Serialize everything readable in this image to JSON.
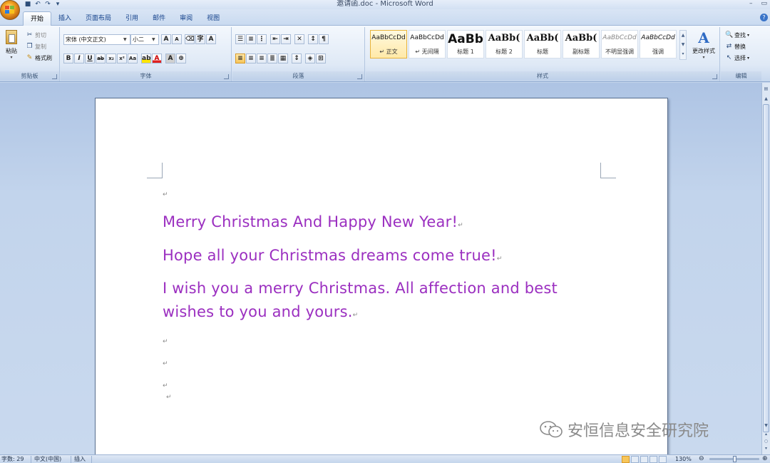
{
  "window": {
    "title": "邀请函.doc - Microsoft Word",
    "minimize": "–",
    "restore": "▭",
    "help": "?"
  },
  "qat": {
    "save_icon": "save-icon",
    "undo_icon": "undo-icon",
    "redo_icon": "redo-icon",
    "customize_icon": "customize-icon"
  },
  "tabs": [
    {
      "label": "开始",
      "active": true
    },
    {
      "label": "插入"
    },
    {
      "label": "页面布局"
    },
    {
      "label": "引用"
    },
    {
      "label": "邮件"
    },
    {
      "label": "审阅"
    },
    {
      "label": "视图"
    }
  ],
  "ribbon": {
    "clipboard": {
      "label": "剪贴板",
      "paste": "粘贴",
      "cut": "剪切",
      "copy": "复制",
      "format_painter": "格式刷"
    },
    "font": {
      "label": "字体",
      "font_name": "宋体 (中文正文)",
      "font_size": "小二"
    },
    "paragraph": {
      "label": "段落"
    },
    "styles": {
      "label": "样式",
      "items": [
        {
          "sample": "AaBbCcDd",
          "name": "↵ 正文"
        },
        {
          "sample": "AaBbCcDd",
          "name": "↵ 无间隔"
        },
        {
          "sample": "AaBb",
          "name": "标题 1"
        },
        {
          "sample": "AaBb(",
          "name": "标题 2"
        },
        {
          "sample": "AaBb(",
          "name": "标题"
        },
        {
          "sample": "AaBb(",
          "name": "副标题"
        },
        {
          "sample": "AaBbCcDd",
          "name": "不明显强调"
        },
        {
          "sample": "AaBbCcDd",
          "name": "强调"
        }
      ],
      "change_styles": "更改样式"
    },
    "editing": {
      "label": "编辑",
      "find": "查找",
      "replace": "替换",
      "select": "选择"
    }
  },
  "document": {
    "lines": [
      "Merry Christmas And Happy New Year!",
      "Hope all your Christmas dreams come true!",
      "I wish you a merry Christmas. All affection and best",
      "wishes to you and yours."
    ],
    "paragraph_mark": "↵",
    "text_color": "#9b2fc0"
  },
  "watermark": {
    "text": "安恒信息安全研究院"
  },
  "statusbar": {
    "word_count": "字数: 29",
    "language": "中文(中国)",
    "mode": "插入",
    "zoom": "130%"
  }
}
